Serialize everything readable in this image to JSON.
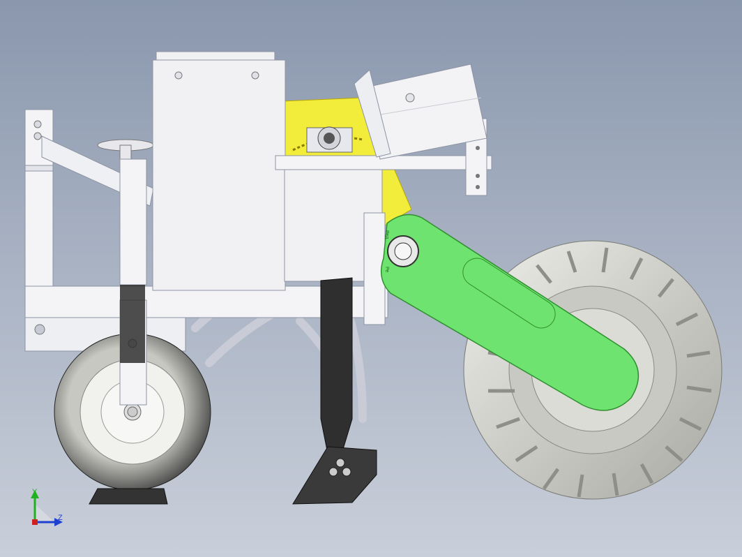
{
  "viewport": {
    "background_top": "#8a97ad",
    "background_bottom": "#c9cfda"
  },
  "model": {
    "frame_color": "#f4f4f6",
    "hopper_color": "#f1f1f3",
    "seed_plate_color": "#f2ec3a",
    "arm_color": "#6fe36f",
    "arm_labels": [
      "Ред",
      "Ре"
    ],
    "tire_color": "#d9d9d4",
    "shank_color": "#3a3a3a",
    "parts": [
      "seed-hopper",
      "mounting-frame",
      "gauge-wheel",
      "furrow-opener",
      "press-wheel",
      "drive-arm",
      "seed-metering-disc",
      "bearing-housing",
      "motor-housing"
    ]
  },
  "triad": {
    "y_label": "Y",
    "z_label": "Z",
    "y_color": "#1fb11f",
    "z_color": "#1f3fd0",
    "x_color": "#d11f1f"
  }
}
